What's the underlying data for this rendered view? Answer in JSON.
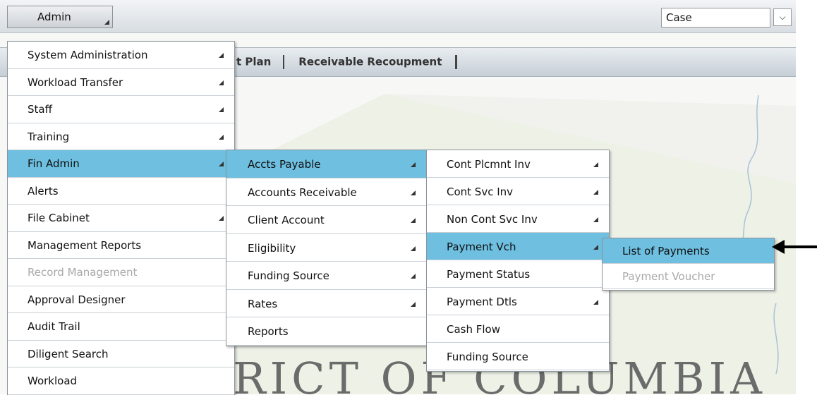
{
  "toolbar": {
    "admin_label": "Admin",
    "search_type": "Case"
  },
  "navbar": {
    "items": [
      "t Plan",
      "Receivable Recoupment"
    ]
  },
  "background": {
    "text": "RICT OF COLUMBIA"
  },
  "menus": {
    "admin": [
      {
        "label": "System Administration",
        "sub": true
      },
      {
        "label": "Workload Transfer",
        "sub": true
      },
      {
        "label": "Staff",
        "sub": true
      },
      {
        "label": "Training",
        "sub": true
      },
      {
        "label": "Fin Admin",
        "sub": true,
        "active": true
      },
      {
        "label": "Alerts"
      },
      {
        "label": "File Cabinet",
        "sub": true
      },
      {
        "label": "Management Reports"
      },
      {
        "label": "Record Management",
        "disabled": true
      },
      {
        "label": "Approval Designer"
      },
      {
        "label": "Audit Trail"
      },
      {
        "label": "Diligent Search"
      },
      {
        "label": "Workload"
      }
    ],
    "fin_admin": [
      {
        "label": "Accts Payable",
        "sub": true,
        "active": true
      },
      {
        "label": "Accounts Receivable",
        "sub": true
      },
      {
        "label": "Client Account",
        "sub": true
      },
      {
        "label": "Eligibility",
        "sub": true
      },
      {
        "label": "Funding Source",
        "sub": true
      },
      {
        "label": "Rates",
        "sub": true
      },
      {
        "label": "Reports"
      }
    ],
    "accts_payable": [
      {
        "label": "Cont Plcmnt Inv",
        "sub": true
      },
      {
        "label": "Cont Svc Inv",
        "sub": true
      },
      {
        "label": "Non Cont Svc Inv",
        "sub": true
      },
      {
        "label": "Payment Vch",
        "sub": true,
        "active": true
      },
      {
        "label": "Payment Status"
      },
      {
        "label": "Payment Dtls",
        "sub": true
      },
      {
        "label": "Cash Flow"
      },
      {
        "label": "Funding Source"
      }
    ],
    "payment_vch": [
      {
        "label": "List of Payments",
        "active": true
      },
      {
        "label": "Payment Voucher",
        "disabled": true
      }
    ]
  },
  "colors": {
    "highlight": "#6ebfe0",
    "disabled_text": "#a8a8a8"
  }
}
